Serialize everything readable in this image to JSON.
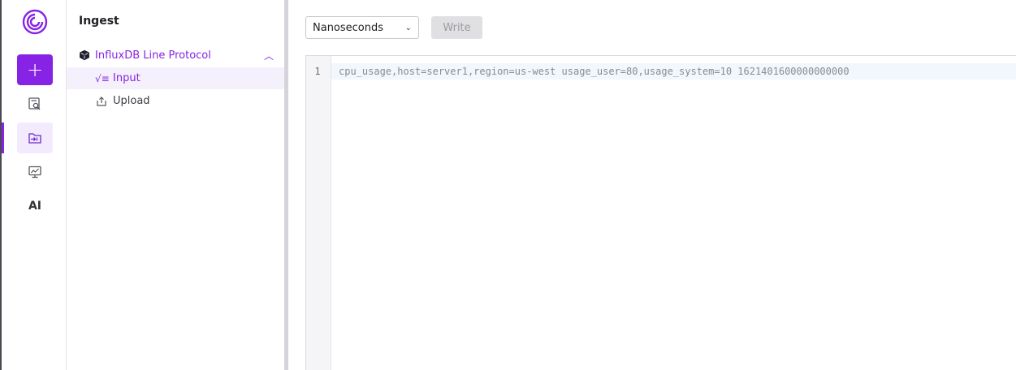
{
  "rail": {
    "items": [
      {
        "name": "new",
        "icon": "plus-icon"
      },
      {
        "name": "explore",
        "icon": "data-explorer-icon"
      },
      {
        "name": "ingest",
        "icon": "ingest-icon",
        "active": true
      },
      {
        "name": "dashboards",
        "icon": "dashboard-icon"
      },
      {
        "name": "ai",
        "label": "AI"
      }
    ],
    "new_glyph": "+",
    "ai_label": "AI"
  },
  "panel": {
    "title": "Ingest",
    "group": {
      "label": "InfluxDB Line Protocol",
      "icon": "influxdb-icon",
      "expanded": true
    },
    "items": [
      {
        "label": "Input",
        "icon": "formula-icon",
        "active": true
      },
      {
        "label": "Upload",
        "icon": "upload-icon",
        "active": false
      }
    ]
  },
  "toolbar": {
    "precision": {
      "selected": "Nanoseconds"
    },
    "write_label": "Write",
    "write_disabled": true
  },
  "editor": {
    "lines": [
      {
        "number": "1",
        "text": "cpu_usage,host=server1,region=us-west usage_user=80,usage_system=10 1621401600000000000"
      }
    ]
  },
  "colors": {
    "accent": "#8623e5",
    "active_bg": "#f4f0fc",
    "disabled_btn": "#e0e0e3"
  }
}
